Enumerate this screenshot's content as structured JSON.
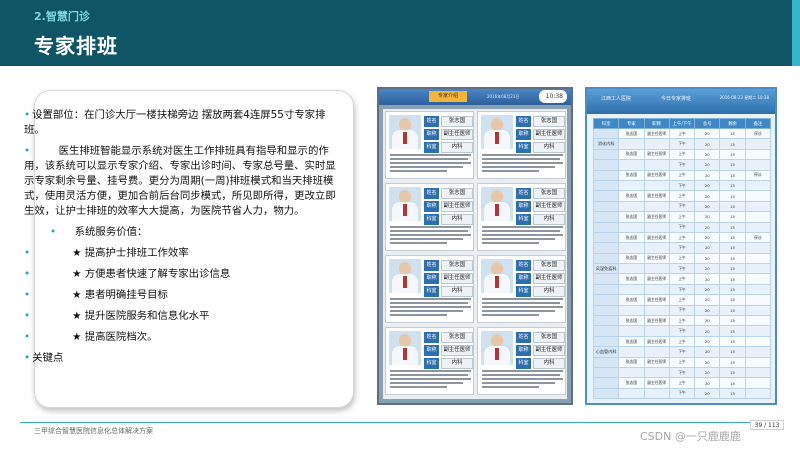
{
  "header": {
    "section": "2.智慧门诊",
    "title": "专家排班"
  },
  "content": {
    "para1": "设置部位：在门诊大厅一楼扶梯旁边 摆放两套4连屏55寸专家排班。",
    "para2_normal": "医生排班智能显示系统对医生工作排班具有指导和显示的作用，该系统可以显示专家介绍、专家出诊时间、专家总号量、实时显示专家剩余号量、挂号费。更分为周期(一周)排班模式和当天排班模式，使用灵活方便，更加合前后台同步模式，所见即所得，更改立即生效，让护士排班的效率大大提高，为医院节省人力，物力。",
    "services_title": "系统服务价值：",
    "services": [
      "★ 提高护士排班工作效率",
      "★ 方便患者快速了解专家出诊信息",
      "★ 患者明确挂号目标",
      "★ 提升医院服务和信息化水平",
      "★ 提高医院档次。"
    ],
    "keypoint": "关键点"
  },
  "screen1": {
    "badge": "专家介绍",
    "date": "2016年08月23日",
    "clock": "10:38",
    "labels": {
      "name": "姓名",
      "title": "职称",
      "dept": "科室"
    },
    "values": {
      "name": "张志国",
      "title": "副主任医师",
      "dept": "内科"
    }
  },
  "screen2": {
    "hospital": "江西工人医院",
    "heading": "今日专家排班",
    "date": "2016-08-23 星期二 10:38",
    "headers": [
      "科室",
      "专家",
      "职称",
      "上午/下午",
      "总号",
      "剩余",
      "备注"
    ],
    "depts": [
      "消化内科",
      "",
      "",
      "",
      "",
      "",
      "风湿免疫科",
      "",
      "",
      "",
      "心血管内科",
      "",
      "",
      ""
    ],
    "doctor": "张志国",
    "title": "副主任医师",
    "am": "上午",
    "pm": "下午",
    "total": "20",
    "remain": "15",
    "note": "停诊"
  },
  "footer": {
    "text": "三甲综合智慧医院信息化总体解决方案",
    "page": "39 / 113",
    "watermark": "CSDN @一只鹿鹿鹿"
  }
}
